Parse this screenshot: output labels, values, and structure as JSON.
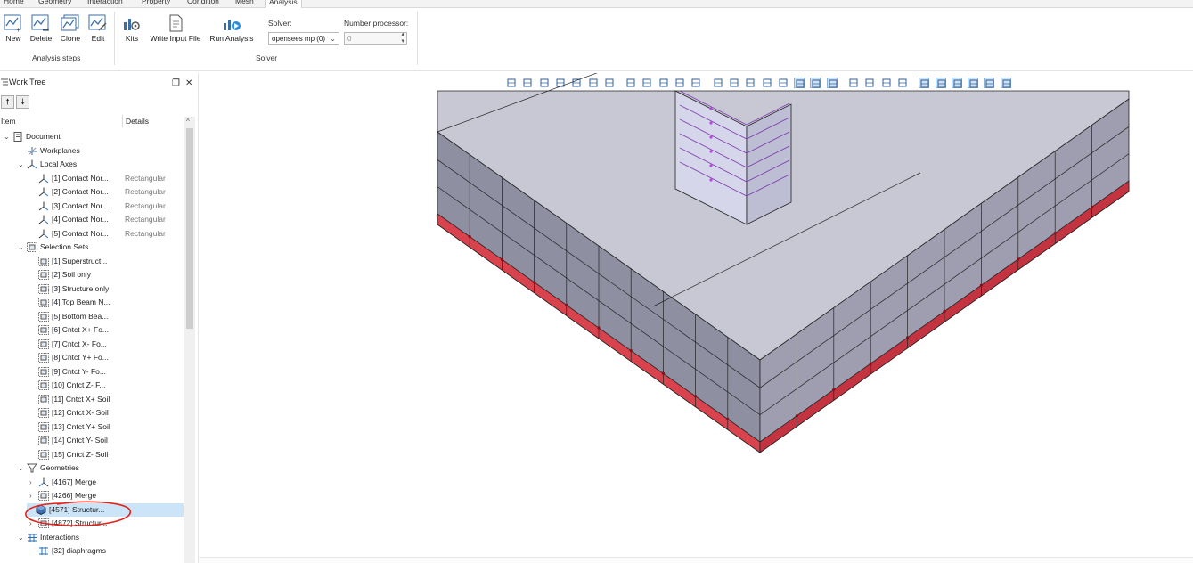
{
  "menu": {
    "tabs": [
      "Home",
      "Geometry",
      "Interaction",
      "Property",
      "Condition",
      "Mesh",
      "Analysis"
    ],
    "active": "Analysis"
  },
  "ribbon": {
    "steps": [
      {
        "label": "New",
        "icon": "new-step-icon"
      },
      {
        "label": "Delete",
        "icon": "delete-step-icon"
      },
      {
        "label": "Clone",
        "icon": "clone-step-icon"
      },
      {
        "label": "Edit",
        "icon": "edit-step-icon"
      }
    ],
    "steps_group": "Analysis steps",
    "solver_buttons": [
      {
        "label": "Kits",
        "icon": "kits-icon"
      },
      {
        "label": "Write Input File",
        "icon": "write-input-file-icon"
      },
      {
        "label": "Run Analysis",
        "icon": "run-analysis-icon"
      }
    ],
    "solver_label": "Solver:",
    "solver_value": "opensees mp (0)",
    "processor_label": "Number processor:",
    "processor_value": "0",
    "solver_group": "Solver"
  },
  "worktree": {
    "title": "Work Tree",
    "col_item": "Item",
    "col_details": "Details",
    "rows": [
      {
        "label": "Document",
        "detail": "",
        "indent": 0,
        "chev": "v",
        "icon": "document-icon"
      },
      {
        "label": "Workplanes",
        "detail": "",
        "indent": 1,
        "chev": "",
        "icon": "workplanes-icon"
      },
      {
        "label": "Local Axes",
        "detail": "",
        "indent": 1,
        "chev": "v",
        "icon": "axes-icon"
      },
      {
        "label": "[1] Contact Nor...",
        "detail": "Rectangular",
        "indent": 2,
        "chev": "",
        "icon": "axes-icon"
      },
      {
        "label": "[2] Contact Nor...",
        "detail": "Rectangular",
        "indent": 2,
        "chev": "",
        "icon": "axes-icon"
      },
      {
        "label": "[3] Contact Nor...",
        "detail": "Rectangular",
        "indent": 2,
        "chev": "",
        "icon": "axes-icon"
      },
      {
        "label": "[4] Contact Nor...",
        "detail": "Rectangular",
        "indent": 2,
        "chev": "",
        "icon": "axes-icon"
      },
      {
        "label": "[5] Contact Nor...",
        "detail": "Rectangular",
        "indent": 2,
        "chev": "",
        "icon": "axes-icon"
      },
      {
        "label": "Selection Sets",
        "detail": "",
        "indent": 1,
        "chev": "v",
        "icon": "selection-set-icon"
      },
      {
        "label": "[1] Superstruct...",
        "detail": "",
        "indent": 2,
        "chev": "",
        "icon": "selection-set-icon"
      },
      {
        "label": "[2] Soil only",
        "detail": "",
        "indent": 2,
        "chev": "",
        "icon": "selection-set-icon"
      },
      {
        "label": "[3] Structure only",
        "detail": "",
        "indent": 2,
        "chev": "",
        "icon": "selection-set-icon"
      },
      {
        "label": "[4] Top Beam N...",
        "detail": "",
        "indent": 2,
        "chev": "",
        "icon": "selection-set-icon"
      },
      {
        "label": "[5] Bottom Bea...",
        "detail": "",
        "indent": 2,
        "chev": "",
        "icon": "selection-set-icon"
      },
      {
        "label": "[6] Cntct X+ Fo...",
        "detail": "",
        "indent": 2,
        "chev": "",
        "icon": "selection-set-icon"
      },
      {
        "label": "[7] Cntct X- Fo...",
        "detail": "",
        "indent": 2,
        "chev": "",
        "icon": "selection-set-icon"
      },
      {
        "label": "[8] Cntct Y+ Fo...",
        "detail": "",
        "indent": 2,
        "chev": "",
        "icon": "selection-set-icon"
      },
      {
        "label": "[9] Cntct Y- Fo...",
        "detail": "",
        "indent": 2,
        "chev": "",
        "icon": "selection-set-icon"
      },
      {
        "label": "[10] Cntct Z- F...",
        "detail": "",
        "indent": 2,
        "chev": "",
        "icon": "selection-set-icon"
      },
      {
        "label": "[11] Cntct X+ Soil",
        "detail": "",
        "indent": 2,
        "chev": "",
        "icon": "selection-set-icon"
      },
      {
        "label": "[12] Cntct X- Soil",
        "detail": "",
        "indent": 2,
        "chev": "",
        "icon": "selection-set-icon"
      },
      {
        "label": "[13] Cntct Y+ Soil",
        "detail": "",
        "indent": 2,
        "chev": "",
        "icon": "selection-set-icon"
      },
      {
        "label": "[14] Cntct Y- Soil",
        "detail": "",
        "indent": 2,
        "chev": "",
        "icon": "selection-set-icon"
      },
      {
        "label": "[15] Cntct Z- Soil",
        "detail": "",
        "indent": 2,
        "chev": "",
        "icon": "selection-set-icon"
      },
      {
        "label": "Geometries",
        "detail": "",
        "indent": 1,
        "chev": "v",
        "icon": "geometries-icon"
      },
      {
        "label": "[4167] Merge",
        "detail": "",
        "indent": 2,
        "chev": ">",
        "icon": "merge-icon"
      },
      {
        "label": "[4266] Merge",
        "detail": "",
        "indent": 2,
        "chev": ">",
        "icon": "selection-set-icon"
      },
      {
        "label": "[4571] Structur...",
        "detail": "",
        "indent": 2,
        "chev": ">",
        "icon": "solid-icon",
        "selected": true
      },
      {
        "label": "[4872] Structur...",
        "detail": "",
        "indent": 2,
        "chev": ">",
        "icon": "selection-set-icon"
      },
      {
        "label": "Interactions",
        "detail": "",
        "indent": 1,
        "chev": "v",
        "icon": "interactions-icon"
      },
      {
        "label": "[32] diaphragms",
        "detail": "",
        "indent": 2,
        "chev": "",
        "icon": "interactions-icon"
      }
    ]
  },
  "colors": {
    "soil_side": "#8f8fa2",
    "soil_top": "#c8c8d4",
    "base_red": "#d9434e",
    "selection_highlight": "#cce4f7",
    "annotation_red": "#e2231a"
  }
}
